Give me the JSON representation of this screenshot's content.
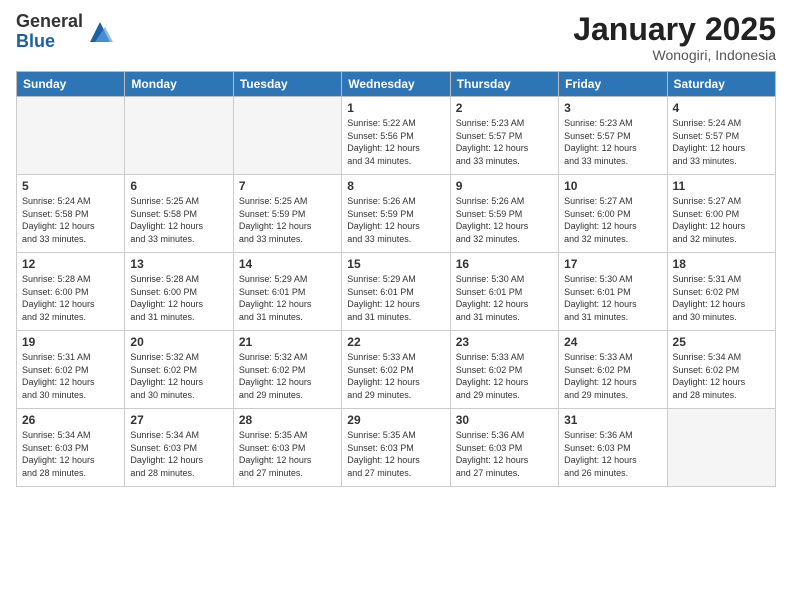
{
  "logo": {
    "general": "General",
    "blue": "Blue"
  },
  "title": "January 2025",
  "subtitle": "Wonogiri, Indonesia",
  "weekdays": [
    "Sunday",
    "Monday",
    "Tuesday",
    "Wednesday",
    "Thursday",
    "Friday",
    "Saturday"
  ],
  "weeks": [
    [
      {
        "day": "",
        "info": ""
      },
      {
        "day": "",
        "info": ""
      },
      {
        "day": "",
        "info": ""
      },
      {
        "day": "1",
        "info": "Sunrise: 5:22 AM\nSunset: 5:56 PM\nDaylight: 12 hours\nand 34 minutes."
      },
      {
        "day": "2",
        "info": "Sunrise: 5:23 AM\nSunset: 5:57 PM\nDaylight: 12 hours\nand 33 minutes."
      },
      {
        "day": "3",
        "info": "Sunrise: 5:23 AM\nSunset: 5:57 PM\nDaylight: 12 hours\nand 33 minutes."
      },
      {
        "day": "4",
        "info": "Sunrise: 5:24 AM\nSunset: 5:57 PM\nDaylight: 12 hours\nand 33 minutes."
      }
    ],
    [
      {
        "day": "5",
        "info": "Sunrise: 5:24 AM\nSunset: 5:58 PM\nDaylight: 12 hours\nand 33 minutes."
      },
      {
        "day": "6",
        "info": "Sunrise: 5:25 AM\nSunset: 5:58 PM\nDaylight: 12 hours\nand 33 minutes."
      },
      {
        "day": "7",
        "info": "Sunrise: 5:25 AM\nSunset: 5:59 PM\nDaylight: 12 hours\nand 33 minutes."
      },
      {
        "day": "8",
        "info": "Sunrise: 5:26 AM\nSunset: 5:59 PM\nDaylight: 12 hours\nand 33 minutes."
      },
      {
        "day": "9",
        "info": "Sunrise: 5:26 AM\nSunset: 5:59 PM\nDaylight: 12 hours\nand 32 minutes."
      },
      {
        "day": "10",
        "info": "Sunrise: 5:27 AM\nSunset: 6:00 PM\nDaylight: 12 hours\nand 32 minutes."
      },
      {
        "day": "11",
        "info": "Sunrise: 5:27 AM\nSunset: 6:00 PM\nDaylight: 12 hours\nand 32 minutes."
      }
    ],
    [
      {
        "day": "12",
        "info": "Sunrise: 5:28 AM\nSunset: 6:00 PM\nDaylight: 12 hours\nand 32 minutes."
      },
      {
        "day": "13",
        "info": "Sunrise: 5:28 AM\nSunset: 6:00 PM\nDaylight: 12 hours\nand 31 minutes."
      },
      {
        "day": "14",
        "info": "Sunrise: 5:29 AM\nSunset: 6:01 PM\nDaylight: 12 hours\nand 31 minutes."
      },
      {
        "day": "15",
        "info": "Sunrise: 5:29 AM\nSunset: 6:01 PM\nDaylight: 12 hours\nand 31 minutes."
      },
      {
        "day": "16",
        "info": "Sunrise: 5:30 AM\nSunset: 6:01 PM\nDaylight: 12 hours\nand 31 minutes."
      },
      {
        "day": "17",
        "info": "Sunrise: 5:30 AM\nSunset: 6:01 PM\nDaylight: 12 hours\nand 31 minutes."
      },
      {
        "day": "18",
        "info": "Sunrise: 5:31 AM\nSunset: 6:02 PM\nDaylight: 12 hours\nand 30 minutes."
      }
    ],
    [
      {
        "day": "19",
        "info": "Sunrise: 5:31 AM\nSunset: 6:02 PM\nDaylight: 12 hours\nand 30 minutes."
      },
      {
        "day": "20",
        "info": "Sunrise: 5:32 AM\nSunset: 6:02 PM\nDaylight: 12 hours\nand 30 minutes."
      },
      {
        "day": "21",
        "info": "Sunrise: 5:32 AM\nSunset: 6:02 PM\nDaylight: 12 hours\nand 29 minutes."
      },
      {
        "day": "22",
        "info": "Sunrise: 5:33 AM\nSunset: 6:02 PM\nDaylight: 12 hours\nand 29 minutes."
      },
      {
        "day": "23",
        "info": "Sunrise: 5:33 AM\nSunset: 6:02 PM\nDaylight: 12 hours\nand 29 minutes."
      },
      {
        "day": "24",
        "info": "Sunrise: 5:33 AM\nSunset: 6:02 PM\nDaylight: 12 hours\nand 29 minutes."
      },
      {
        "day": "25",
        "info": "Sunrise: 5:34 AM\nSunset: 6:02 PM\nDaylight: 12 hours\nand 28 minutes."
      }
    ],
    [
      {
        "day": "26",
        "info": "Sunrise: 5:34 AM\nSunset: 6:03 PM\nDaylight: 12 hours\nand 28 minutes."
      },
      {
        "day": "27",
        "info": "Sunrise: 5:34 AM\nSunset: 6:03 PM\nDaylight: 12 hours\nand 28 minutes."
      },
      {
        "day": "28",
        "info": "Sunrise: 5:35 AM\nSunset: 6:03 PM\nDaylight: 12 hours\nand 27 minutes."
      },
      {
        "day": "29",
        "info": "Sunrise: 5:35 AM\nSunset: 6:03 PM\nDaylight: 12 hours\nand 27 minutes."
      },
      {
        "day": "30",
        "info": "Sunrise: 5:36 AM\nSunset: 6:03 PM\nDaylight: 12 hours\nand 27 minutes."
      },
      {
        "day": "31",
        "info": "Sunrise: 5:36 AM\nSunset: 6:03 PM\nDaylight: 12 hours\nand 26 minutes."
      },
      {
        "day": "",
        "info": ""
      }
    ]
  ]
}
